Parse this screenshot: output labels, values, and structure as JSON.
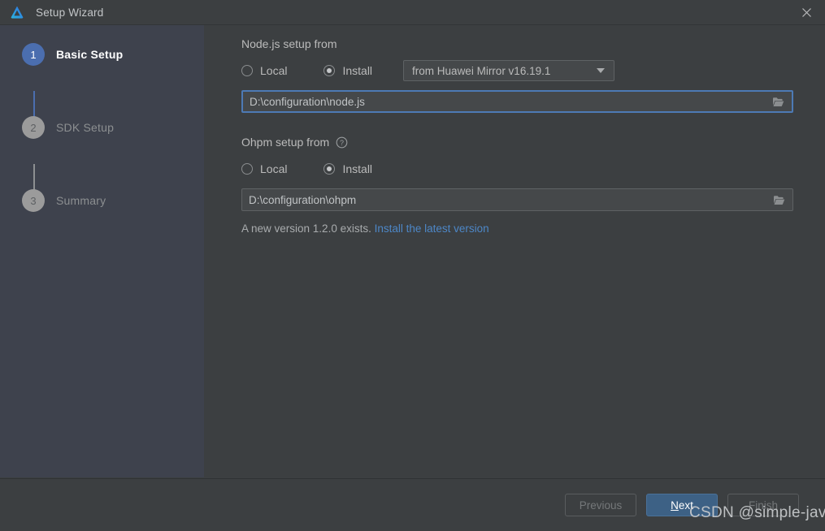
{
  "window": {
    "title": "Setup Wizard",
    "logo_icon": "deveco-logo-icon",
    "close_icon": "close-icon"
  },
  "sidebar": {
    "steps": [
      {
        "number": "1",
        "label": "Basic Setup",
        "state": "active"
      },
      {
        "number": "2",
        "label": "SDK Setup",
        "state": "inactive"
      },
      {
        "number": "3",
        "label": "Summary",
        "state": "inactive"
      }
    ]
  },
  "main": {
    "nodejs": {
      "section_label": "Node.js setup from",
      "local_label": "Local",
      "install_label": "Install",
      "mirror_value": "from Huawei Mirror v16.19.1",
      "path_value": "D:\\configuration\\node.js",
      "browse_icon": "folder-icon",
      "dropdown_icon": "chevron-down-icon"
    },
    "ohpm": {
      "section_label": "Ohpm setup from",
      "help_icon": "help-circle-icon",
      "local_label": "Local",
      "install_label": "Install",
      "path_value": "D:\\configuration\\ohpm",
      "browse_icon": "folder-icon",
      "note_text": "A new version 1.2.0 exists. ",
      "note_link": "Install the latest version"
    }
  },
  "footer": {
    "previous_label": "Previous",
    "next_label_mnemonic": "N",
    "next_label_rest": "ext",
    "finish_label": "Finish"
  },
  "watermark": {
    "text": "CSDN @simple-java"
  },
  "colors": {
    "accent_blue": "#4b6eaf",
    "link_blue": "#4d87c7",
    "primary_button": "#3d6185",
    "panel_bg": "#3c3f41",
    "sidebar_bg": "#3e424d"
  }
}
